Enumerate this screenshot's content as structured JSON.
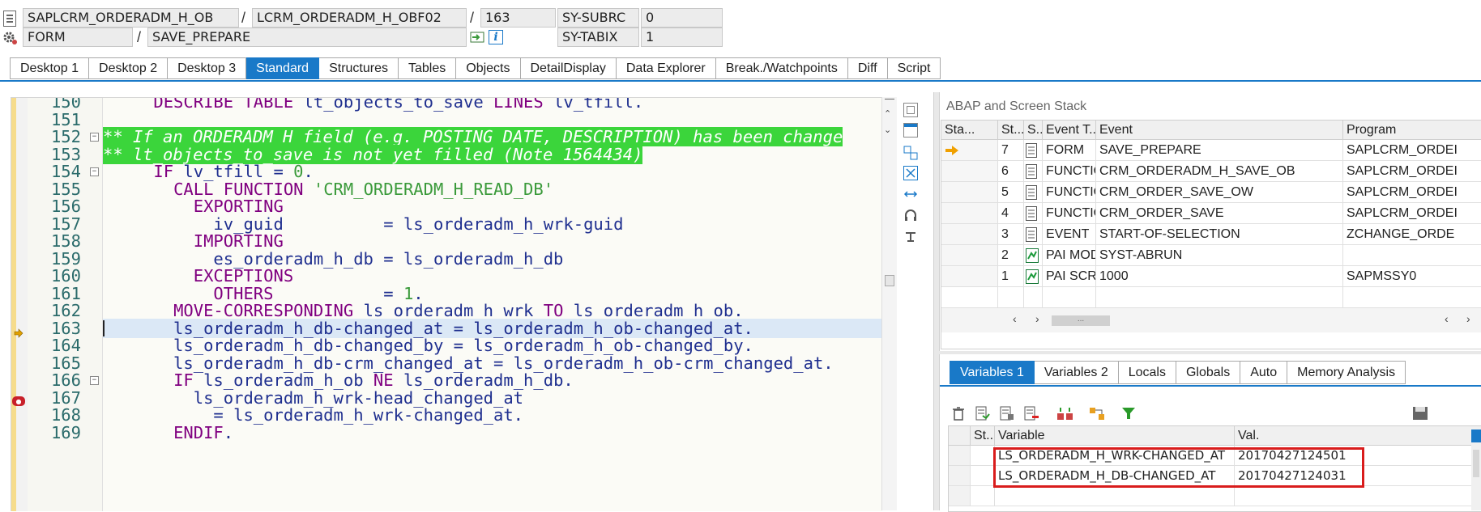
{
  "header": {
    "program": "SAPLCRM_ORDERADM_H_OB",
    "sep1": "/",
    "include": "LCRM_ORDERADM_H_OBF02",
    "sep2": "/",
    "line": "163",
    "subrc_label": "SY-SUBRC",
    "subrc_value": "0",
    "event_type": "FORM",
    "sep3": "/",
    "event_name": "SAVE_PREPARE",
    "tabix_label": "SY-TABIX",
    "tabix_value": "1",
    "info_icon_text": "i"
  },
  "tabs": [
    "Desktop 1",
    "Desktop 2",
    "Desktop 3",
    "Standard",
    "Structures",
    "Tables",
    "Objects",
    "DetailDisplay",
    "Data Explorer",
    "Break./Watchpoints",
    "Diff",
    "Script"
  ],
  "active_tab": "Standard",
  "code": {
    "lines": [
      {
        "no": "150",
        "parts": [
          [
            "    ",
            ""
          ],
          [
            "DESCRIBE TABLE",
            "kw"
          ],
          [
            " lt_objects_to_save ",
            "id"
          ],
          [
            "LINES",
            "kw"
          ],
          [
            " lv_tfill.",
            "id"
          ]
        ]
      },
      {
        "no": "151",
        "parts": []
      },
      {
        "no": "152",
        "fold": "-",
        "parts": [
          [
            "** If an ORDERADM_H field (e.g. POSTING_DATE, DESCRIPTION) has been change",
            "cmt"
          ]
        ]
      },
      {
        "no": "153",
        "parts": [
          [
            "** lt_objects_to_save is not yet filled (Note 1564434)",
            "cmt"
          ]
        ]
      },
      {
        "no": "154",
        "fold": "-",
        "parts": [
          [
            "    ",
            ""
          ],
          [
            "IF",
            "kw"
          ],
          [
            " lv_tfill = ",
            "id"
          ],
          [
            "0",
            "num"
          ],
          [
            ".",
            "id"
          ]
        ]
      },
      {
        "no": "155",
        "parts": [
          [
            "      ",
            ""
          ],
          [
            "CALL FUNCTION",
            "kw"
          ],
          [
            " ",
            ""
          ],
          [
            "'CRM_ORDERADM_H_READ_DB'",
            "lit"
          ]
        ]
      },
      {
        "no": "156",
        "parts": [
          [
            "        ",
            ""
          ],
          [
            "EXPORTING",
            "kw"
          ]
        ]
      },
      {
        "no": "157",
        "parts": [
          [
            "          iv_guid          = ls_orderadm_h_wrk-guid",
            "id"
          ]
        ]
      },
      {
        "no": "158",
        "parts": [
          [
            "        ",
            ""
          ],
          [
            "IMPORTING",
            "kw"
          ]
        ]
      },
      {
        "no": "159",
        "parts": [
          [
            "          es_orderadm_h_db = ls_orderadm_h_db",
            "id"
          ]
        ]
      },
      {
        "no": "160",
        "parts": [
          [
            "        ",
            ""
          ],
          [
            "EXCEPTIONS",
            "kw"
          ]
        ]
      },
      {
        "no": "161",
        "parts": [
          [
            "          ",
            ""
          ],
          [
            "OTHERS",
            "kw"
          ],
          [
            "           = ",
            "id"
          ],
          [
            "1",
            "num"
          ],
          [
            ".",
            "id"
          ]
        ]
      },
      {
        "no": "162",
        "parts": [
          [
            "      ",
            ""
          ],
          [
            "MOVE-CORRESPONDING",
            "kw"
          ],
          [
            " ls_orderadm_h_wrk ",
            "id"
          ],
          [
            "TO",
            "kw"
          ],
          [
            " ls_orderadm_h_ob.",
            "id"
          ]
        ]
      },
      {
        "no": "163",
        "current": true,
        "parts": [
          [
            "      ls_orderadm_h_db-changed_at = ls_orderadm_h_ob-changed_at.",
            "id"
          ]
        ]
      },
      {
        "no": "164",
        "parts": [
          [
            "      ls_orderadm_h_db-changed_by = ls_orderadm_h_ob-changed_by.",
            "id"
          ]
        ]
      },
      {
        "no": "165",
        "parts": [
          [
            "      ls_orderadm_h_db-crm_changed_at = ls_orderadm_h_ob-crm_changed_at.",
            "id"
          ]
        ]
      },
      {
        "no": "166",
        "fold": "-",
        "parts": [
          [
            "      ",
            ""
          ],
          [
            "IF",
            "kw"
          ],
          [
            " ls_orderadm_h_ob ",
            "id"
          ],
          [
            "NE",
            "kw"
          ],
          [
            " ls_orderadm_h_db.",
            "id"
          ]
        ]
      },
      {
        "no": "167",
        "breakpoint": true,
        "parts": [
          [
            "        ls_orderadm_h_wrk-head_changed_at",
            "id"
          ]
        ]
      },
      {
        "no": "168",
        "parts": [
          [
            "          = ls_orderadm_h_wrk-changed_at.",
            "id"
          ]
        ]
      },
      {
        "no": "169",
        "parts": [
          [
            "      ",
            ""
          ],
          [
            "ENDIF",
            "kw"
          ],
          [
            ".",
            "id"
          ]
        ]
      }
    ]
  },
  "stack": {
    "title": "ABAP and Screen Stack",
    "columns": [
      "Sta...",
      "St...",
      "S...",
      "Event T...",
      "Event",
      "Program"
    ],
    "rows": [
      {
        "marker": "arrow",
        "level": "7",
        "icon": "doc",
        "type": "FORM",
        "event": "SAVE_PREPARE",
        "program": "SAPLCRM_ORDEI"
      },
      {
        "marker": "",
        "level": "6",
        "icon": "doc",
        "type": "FUNCTIO...",
        "event": "CRM_ORDERADM_H_SAVE_OB",
        "program": "SAPLCRM_ORDEI"
      },
      {
        "marker": "",
        "level": "5",
        "icon": "doc",
        "type": "FUNCTIO...",
        "event": "CRM_ORDER_SAVE_OW",
        "program": "SAPLCRM_ORDEI"
      },
      {
        "marker": "",
        "level": "4",
        "icon": "doc",
        "type": "FUNCTIO...",
        "event": "CRM_ORDER_SAVE",
        "program": "SAPLCRM_ORDEI"
      },
      {
        "marker": "",
        "level": "3",
        "icon": "doc",
        "type": "EVENT",
        "event": "START-OF-SELECTION",
        "program": "ZCHANGE_ORDE"
      },
      {
        "marker": "",
        "level": "2",
        "icon": "screen",
        "type": "PAI MOD...",
        "event": "SYST-ABRUN",
        "program": ""
      },
      {
        "marker": "",
        "level": "1",
        "icon": "screen",
        "type": "PAI SCRE...",
        "event": "1000",
        "program": "SAPMSSY0"
      }
    ],
    "scroll_thumb": "..."
  },
  "var_tabs": [
    "Variables 1",
    "Variables 2",
    "Locals",
    "Globals",
    "Auto",
    "Memory Analysis"
  ],
  "active_var_tab": "Variables 1",
  "variables": {
    "columns": [
      "St...",
      "Variable",
      "Val."
    ],
    "rows": [
      {
        "name": "LS_ORDERADM_H_WRK-CHANGED_AT",
        "value": "20170427124501"
      },
      {
        "name": "LS_ORDERADM_H_DB-CHANGED_AT",
        "value": "20170427124031"
      }
    ]
  },
  "colors": {
    "accent": "#1979c8",
    "comment_bg": "#3bd53b",
    "highlight_box": "#d91c1c"
  }
}
